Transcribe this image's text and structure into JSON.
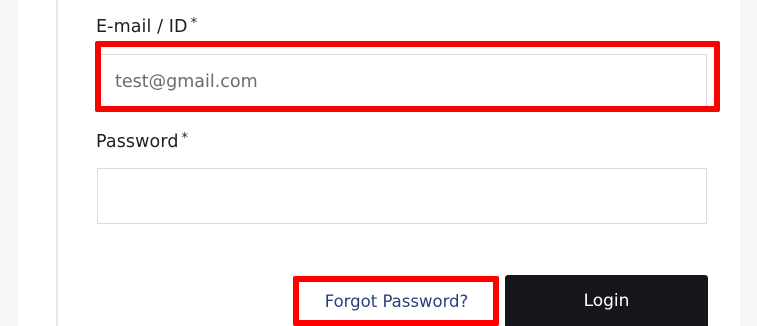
{
  "form": {
    "email": {
      "label": "E-mail / ID",
      "required_mark": "*",
      "value": "test@gmail.com"
    },
    "password": {
      "label": "Password",
      "required_mark": "*",
      "value": ""
    },
    "forgot_password_label": "Forgot Password?",
    "login_label": "Login"
  },
  "colors": {
    "highlight": "#ff0000",
    "button_bg": "#15161c",
    "link": "#2a3f7d"
  }
}
